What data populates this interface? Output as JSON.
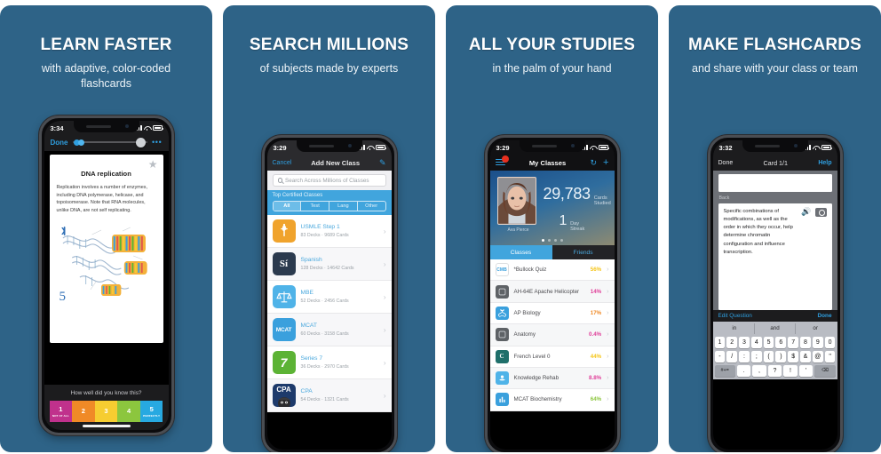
{
  "theme": {
    "background": "#2e6387",
    "accent": "#2f9fe0",
    "brand_blue": "#41a5dd"
  },
  "panels": [
    {
      "headline": "LEARN FASTER",
      "subline": "with adaptive, color-coded flashcards",
      "phone": {
        "status": {
          "time": "3:34"
        },
        "toolbar": {
          "done": "Done",
          "more": "•••"
        },
        "card": {
          "title": "DNA replication",
          "body": "Replication involves a number of enzymes, including DNA polymerase, helicase, and topoisomerase. Note that RNA molecules, unlike DNA, are not self replicating.",
          "page_number": "5",
          "star_icon": "star-icon"
        },
        "prompt": "How well did you know this?",
        "ratings": [
          {
            "num": "1",
            "caption": "NOT AT ALL",
            "color": "#c0318c"
          },
          {
            "num": "2",
            "caption": "",
            "color": "#f08a27"
          },
          {
            "num": "3",
            "caption": "",
            "color": "#f6cd31"
          },
          {
            "num": "4",
            "caption": "",
            "color": "#8cc63e"
          },
          {
            "num": "5",
            "caption": "PERFECTLY",
            "color": "#27a9e1"
          }
        ]
      }
    },
    {
      "headline": "SEARCH MILLIONS",
      "subline": "of subjects made by experts",
      "phone": {
        "status": {
          "time": "3:29"
        },
        "navbar": {
          "left": "Cancel",
          "title": "Add New Class",
          "right_icon": "compose-icon"
        },
        "search": {
          "placeholder": "Search Across Millions of Classes",
          "icon": "search-icon"
        },
        "section_title": "Top Certified Classes",
        "segments": [
          {
            "label": "All",
            "active": true
          },
          {
            "label": "Test",
            "active": false
          },
          {
            "label": "Lang",
            "active": false
          },
          {
            "label": "Other",
            "active": false
          }
        ],
        "classes": [
          {
            "name": "USMLE Step 1",
            "sub": "83 Decks · 9689 Cards",
            "icon": "caduceus-icon",
            "icon_bg": "#f0a32c",
            "icon_text": ""
          },
          {
            "name": "Spanish",
            "sub": "128 Decks · 14642 Cards",
            "icon": "si-icon",
            "icon_bg": "#2b3a4e",
            "icon_text": "Sí"
          },
          {
            "name": "MBE",
            "sub": "52 Decks · 2456 Cards",
            "icon": "scales-icon",
            "icon_bg": "#4fb3e8",
            "icon_text": ""
          },
          {
            "name": "MCAT",
            "sub": "60 Decks · 3158 Cards",
            "icon": "mcat-icon",
            "icon_bg": "#3aa0dd",
            "icon_text": "MCAT"
          },
          {
            "name": "Series 7",
            "sub": "36 Decks · 2970 Cards",
            "icon": "seven-icon",
            "icon_bg": "#5cb335",
            "icon_text": "7"
          },
          {
            "name": "CPA",
            "sub": "54 Decks · 1321 Cards",
            "icon": "cpa-icon",
            "icon_bg": "#1d3a6b",
            "icon_text": "CPA"
          }
        ]
      }
    },
    {
      "headline": "ALL YOUR STUDIES",
      "subline": "in the palm of your hand",
      "phone": {
        "status": {
          "time": "3:29"
        },
        "navbar": {
          "menu_icon": "hamburger-icon",
          "title": "My Classes",
          "refresh_icon": "refresh-icon",
          "add_icon": "plus-icon"
        },
        "hero": {
          "user_name": "Ava Pierce",
          "cards_studied_value": "29,783",
          "cards_studied_label": "Cards\nStudied",
          "streak_value": "1",
          "streak_label": "Day\nStreak"
        },
        "tabs": [
          {
            "label": "Classes",
            "active": true
          },
          {
            "label": "Friends",
            "active": false
          }
        ],
        "rows": [
          {
            "name": "*Bullock Quiz",
            "pct": "56%",
            "pct_color": "#f5c518",
            "icon_bg": "#ffffff",
            "icon_text": "CMB"
          },
          {
            "name": "AH-64E Apache Helicopter",
            "pct": "14%",
            "pct_color": "#e0409a",
            "icon_bg": "#5e6266",
            "icon_text": ""
          },
          {
            "name": "AP Biology",
            "pct": "17%",
            "pct_color": "#f08a27",
            "icon_bg": "#3aa0dd",
            "icon_text": ""
          },
          {
            "name": "Anatomy",
            "pct": "0.4%",
            "pct_color": "#e0409a",
            "icon_bg": "#5e6266",
            "icon_text": ""
          },
          {
            "name": "French Level 0",
            "pct": "44%",
            "pct_color": "#f5c518",
            "icon_bg": "#1f6f6a",
            "icon_text": "C"
          },
          {
            "name": "Knowledge Rehab",
            "pct": "8.8%",
            "pct_color": "#e0409a",
            "icon_bg": "#4fb3e8",
            "icon_text": ""
          },
          {
            "name": "MCAT Biochemistry",
            "pct": "64%",
            "pct_color": "#8cc63e",
            "icon_bg": "#3aa0dd",
            "icon_text": ""
          }
        ]
      }
    },
    {
      "headline": "MAKE FLASHCARDS",
      "subline": "and share with your class or team",
      "phone": {
        "status": {
          "time": "3:32"
        },
        "navbar": {
          "left": "Done",
          "title": "Card 1/1",
          "right": "Help"
        },
        "editor": {
          "front_value": "",
          "back_label": "Back",
          "back_value": "Specific combinations of modifications, as well as the order in which they occur, help determine chromatin configuration and influence transcription.",
          "speaker_icon": "speaker-icon",
          "camera_icon": "camera-icon"
        },
        "keyboard_bar": {
          "left": "Edit Question",
          "right": "Done"
        },
        "predictions": [
          "in",
          "and",
          "or"
        ],
        "keys": {
          "row1": [
            "1",
            "2",
            "3",
            "4",
            "5",
            "6",
            "7",
            "8",
            "9",
            "0"
          ],
          "row2": [
            "-",
            "/",
            ":",
            ";",
            "(",
            ")",
            "$",
            "&",
            "@",
            "\""
          ],
          "row3_left": "#+=",
          "row3": [
            ".",
            ",",
            "?",
            "!",
            "'"
          ],
          "backspace_icon": "backspace-icon"
        }
      }
    }
  ]
}
